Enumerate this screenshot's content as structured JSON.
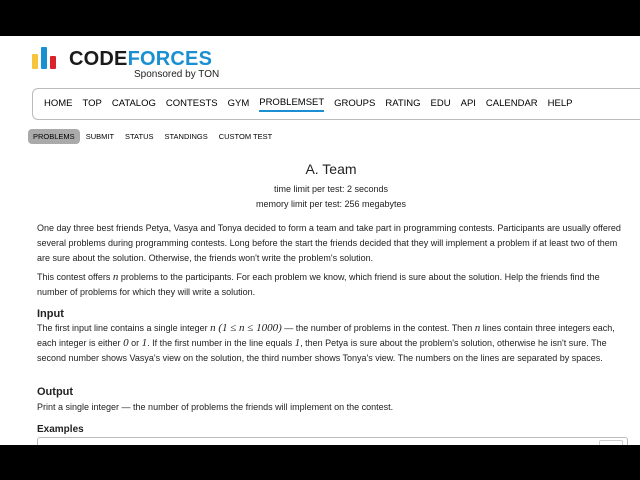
{
  "logo": {
    "code": "CODE",
    "forces": "FORCES",
    "sponsor": "Sponsored by TON"
  },
  "menu": [
    "HOME",
    "TOP",
    "CATALOG",
    "CONTESTS",
    "GYM",
    "PROBLEMSET",
    "GROUPS",
    "RATING",
    "EDU",
    "API",
    "CALENDAR",
    "HELP"
  ],
  "menu_active": "PROBLEMSET",
  "submenu": [
    "PROBLEMS",
    "SUBMIT",
    "STATUS",
    "STANDINGS",
    "CUSTOM TEST"
  ],
  "submenu_active": "PROBLEMS",
  "problem": {
    "title": "A. Team",
    "time_limit": "time limit per test: 2 seconds",
    "memory_limit": "memory limit per test: 256 megabytes",
    "legend_1": "One day three best friends Petya, Vasya and Tonya decided to form a team and take part in programming contests. Participants are usually offered several problems during programming contests. Long before the start the friends decided that they will implement a problem if at least two of them are sure about the solution. Otherwise, the friends won't write the problem's solution.",
    "legend_2_a": "This contest offers ",
    "legend_2_n": "n",
    "legend_2_b": " problems to the participants. For each problem we know, which friend is sure about the solution. Help the friends find the number of problems for which they will write a solution.",
    "input_title": "Input",
    "input_a": "The first input line contains a single integer ",
    "input_math1": "n (1 ≤ n ≤ 1000)",
    "input_b": " — the number of problems in the contest. Then ",
    "input_n": "n",
    "input_c": " lines contain three integers each, each integer is either ",
    "input_zero": "0",
    "input_or": " or ",
    "input_one": "1",
    "input_d": ". If the first number in the line equals ",
    "input_one2": "1",
    "input_e": ", then Petya is sure about the problem's solution, otherwise he isn't sure. The second number shows Vasya's view on the solution, the third number shows Tonya's view. The numbers on the lines are separated by spaces.",
    "output_title": "Output",
    "output_text": "Print a single integer — the number of problems the friends will implement on the contest.",
    "examples_title": "Examples"
  }
}
